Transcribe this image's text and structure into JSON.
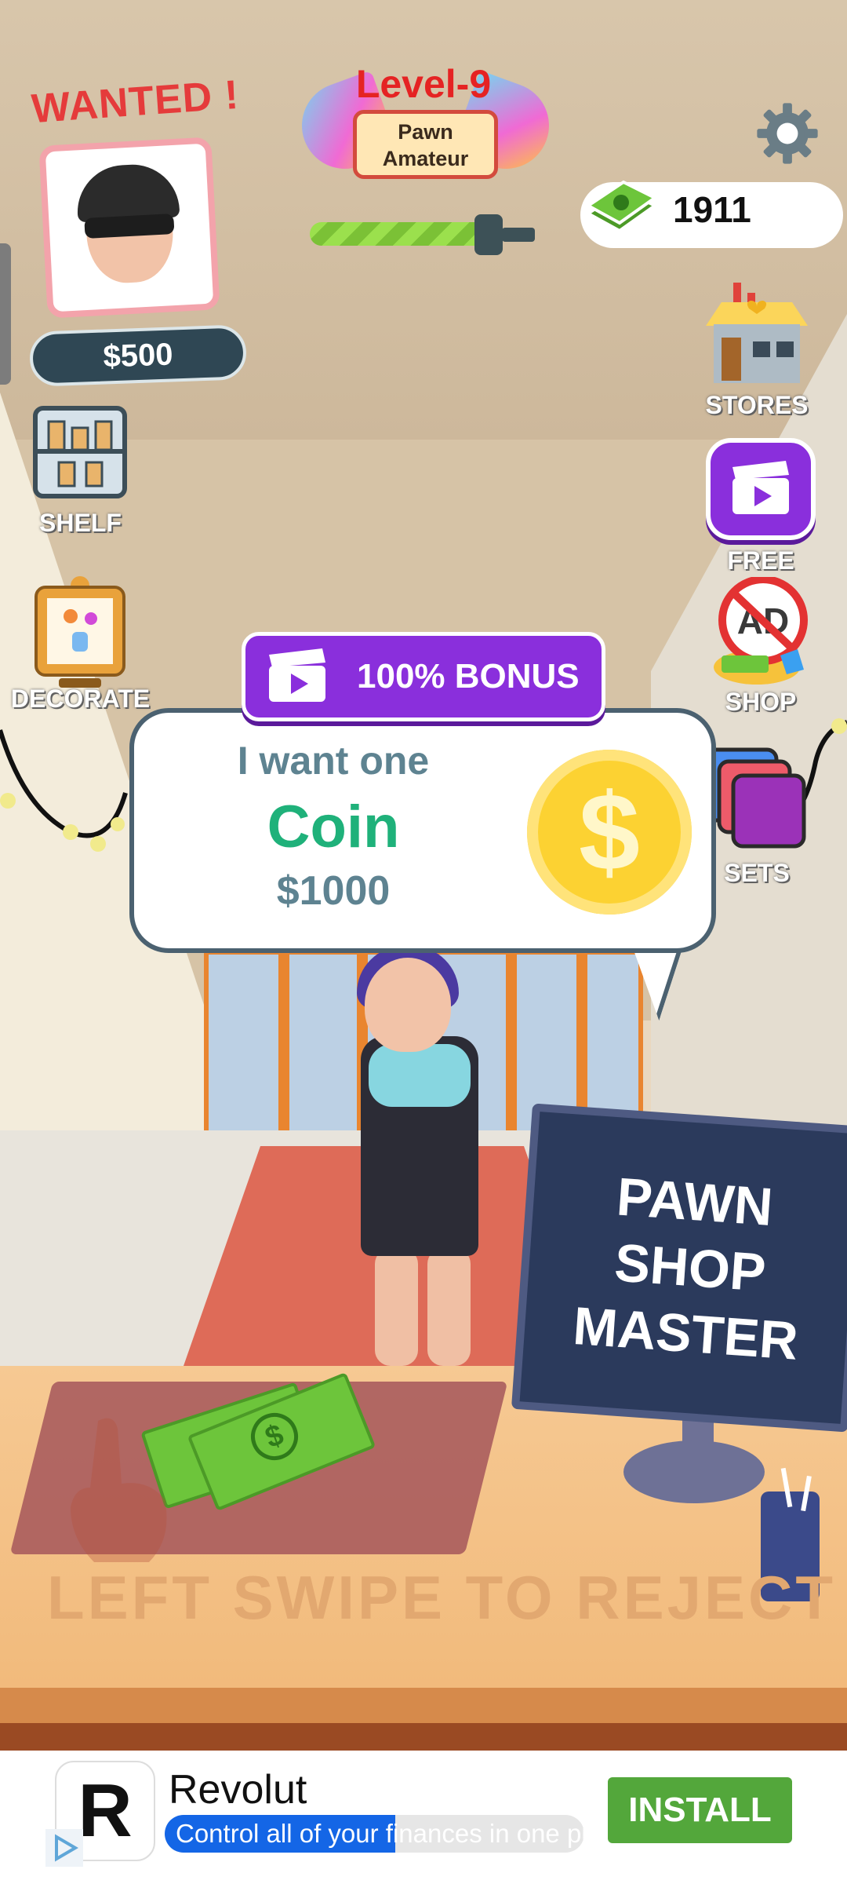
{
  "hud": {
    "wanted_title": "WANTED !",
    "wanted_price": "$500",
    "level": "Level-9",
    "rank": "Pawn Amateur",
    "level_progress_fraction": 0.85,
    "cash": "1911"
  },
  "side_buttons": {
    "stores": "STORES",
    "free": "FREE",
    "shop": "SHOP",
    "sets": "SETS",
    "shelf": "SHELF",
    "decorate": "DECORATE"
  },
  "offer": {
    "bonus_label": "100% BONUS",
    "want_line": "I want one",
    "item_name": "Coin",
    "item_price": "$1000",
    "coin_symbol": "$"
  },
  "scene": {
    "monitor_text": "PAWN\nSHOP\nMASTER",
    "swipe_hint": "LEFT SWIPE TO REJECT"
  },
  "ad": {
    "logo_letter": "R",
    "title": "Revolut",
    "subtitle": "Control all of your finances in one place",
    "install": "INSTALL"
  },
  "colors": {
    "accent_purple": "#8a2fdc",
    "level_red": "#e52323",
    "coin_gold": "#fcd232",
    "install_green": "#53a73b",
    "item_green": "#1fb17a"
  }
}
